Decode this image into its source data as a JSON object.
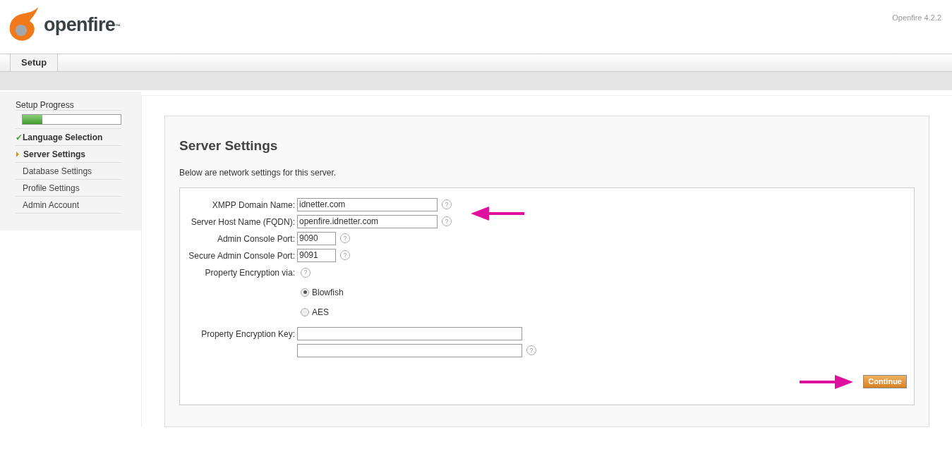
{
  "header": {
    "logo_text": "openfire",
    "trademark": "™",
    "version": "Openfire 4.2.2"
  },
  "tabs": [
    {
      "label": "Setup",
      "selected": true
    }
  ],
  "sidebar": {
    "title": "Setup Progress",
    "progress": {
      "level": 0.2
    },
    "items": [
      {
        "label": "Language Selection",
        "kind": "done",
        "check": "✓"
      },
      {
        "label": "Server Settings",
        "kind": "current"
      },
      {
        "label": "Database Settings",
        "kind": "pending"
      },
      {
        "label": "Profile Settings",
        "kind": "pending"
      },
      {
        "label": "Admin Account",
        "kind": "pending"
      }
    ]
  },
  "main": {
    "title": "Server Settings",
    "description": "Below are network settings for this server.",
    "fields": [
      {
        "kind": "text",
        "label": "XMPP Domain Name:",
        "value": "idnetter.com",
        "help": "?"
      },
      {
        "kind": "text",
        "label": "Server Host Name (FQDN):",
        "value": "openfire.idnetter.com",
        "help": "?"
      },
      {
        "kind": "port",
        "label": "Admin Console Port:",
        "value": "9090",
        "help": "?"
      },
      {
        "kind": "port",
        "label": "Secure Admin Console Port:",
        "value": "9091",
        "help": "?"
      },
      {
        "kind": "radio",
        "label": "Property Encryption via:",
        "help": "?",
        "options": [
          {
            "label": "Blowfish",
            "selected": true
          },
          {
            "label": "AES",
            "selected": false
          }
        ]
      },
      {
        "kind": "key",
        "label": "Property Encryption Key:"
      },
      {
        "kind": "key",
        "help": "?"
      }
    ],
    "button": "Continue"
  }
}
